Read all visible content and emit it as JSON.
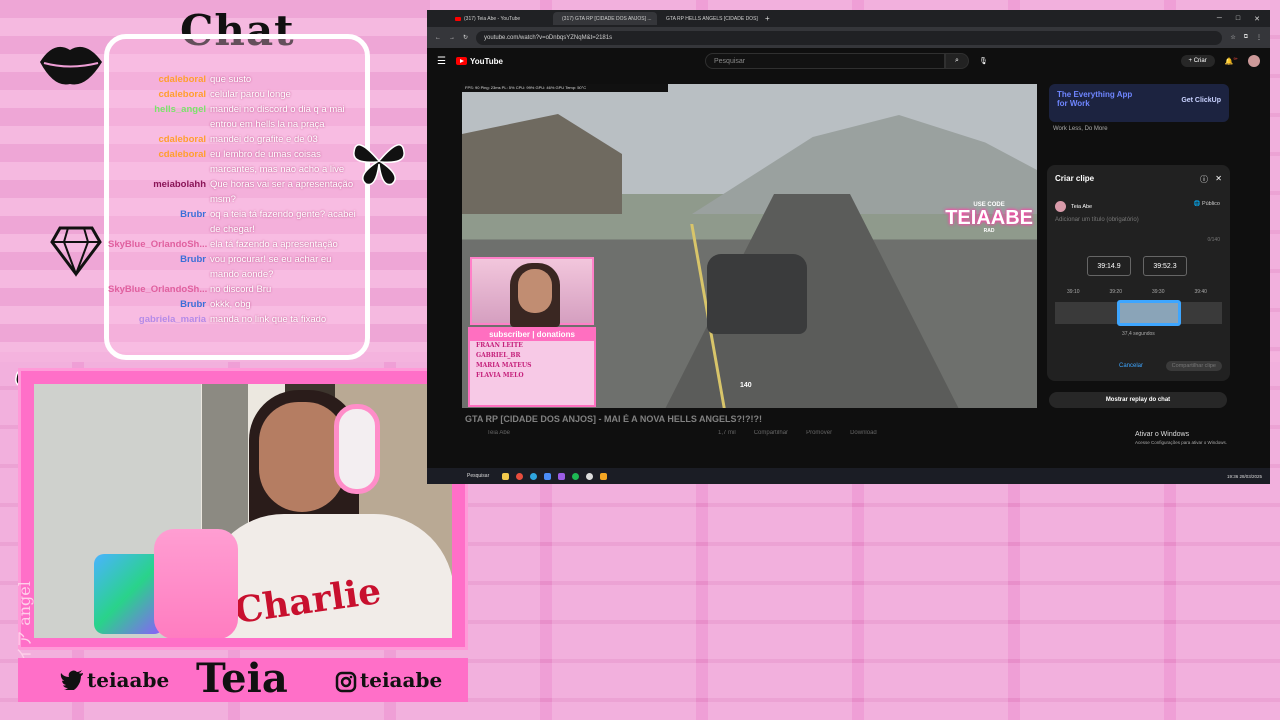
{
  "chat": {
    "title": "Chat",
    "messages": [
      {
        "user": "cdaleboral",
        "text": "que susto",
        "color": "#ff9f2e"
      },
      {
        "user": "cdaleboral",
        "text": "celular parou longe",
        "color": "#ff9f2e"
      },
      {
        "user": "hells_angel",
        "text": "mandei no discord o dia q a mai",
        "color": "#7be36b"
      },
      {
        "user": "",
        "text": "entrou em hells la na praça",
        "color": "#7be36b"
      },
      {
        "user": "cdaleboral",
        "text": "mandei do grafite e de 03",
        "color": "#ff9f2e"
      },
      {
        "user": "cdaleboral",
        "text": "eu lembro de umas coisas",
        "color": "#ff9f2e"
      },
      {
        "user": "",
        "text": "marcantes, mas nao acho a live",
        "color": "#ff9f2e"
      },
      {
        "user": "meiabolahh",
        "text": "Que horas vai ser a apresentação",
        "color": "#8a1457"
      },
      {
        "user": "",
        "text": "msm?",
        "color": "#8a1457"
      },
      {
        "user": "Brubr",
        "text": "oq a teia tá fazendo gente? acabei",
        "color": "#3a6fd8"
      },
      {
        "user": "",
        "text": "de chegar!",
        "color": "#3a6fd8"
      },
      {
        "user": "SkyBlue_OrlandoSh...",
        "text": "ela tá fazendo a apresentação",
        "color": "#e0609f"
      },
      {
        "user": "Brubr",
        "text": "vou procurar! se eu achar eu",
        "color": "#3a6fd8"
      },
      {
        "user": "",
        "text": "mando aonde?",
        "color": "#3a6fd8"
      },
      {
        "user": "SkyBlue_OrlandoSh...",
        "text": "no discord Bru",
        "color": "#e0609f"
      },
      {
        "user": "Brubr",
        "text": "okkk, obg",
        "color": "#3a6fd8"
      },
      {
        "user": "gabriela_maria",
        "text": "manda no link que ta fixado",
        "color": "#b58be8"
      }
    ]
  },
  "socials": {
    "twitter": "teiaabe",
    "brand": "Teia",
    "instagram": "teiaabe",
    "side_text": "テイア angel"
  },
  "webcam": {
    "shirt_text": "Charlie"
  },
  "browser": {
    "tabs": [
      {
        "label": "(317) Teia Abe - YouTube"
      },
      {
        "label": "(317) GTA RP [CIDADE DOS ANJOS] ..."
      },
      {
        "label": "GTA RP HELLS ANGELS [CIDADE DOS]"
      }
    ],
    "url": "youtube.com/watch?v=oDnbqsYZNqM&t=2181s",
    "search_placeholder": "Pesquisar",
    "create_label": "Criar",
    "notif_count": "9+",
    "logo": "YouTube"
  },
  "video": {
    "hud": "FPS: 90    Ping: 23ms  PL: 5%    CPU: 99%    GPU: 46%    GPU Temp: 50°C",
    "promo_line1": "USE CODE",
    "promo_line2": "TEIAABE",
    "promo_line3": "RAD",
    "speed": "140",
    "subs_header": "subscriber | donations",
    "subs": [
      "FRAAN LEITE",
      "GABRIEL_BR",
      "MARIA MATEUS",
      "FLAVIA MELO"
    ],
    "title": "GTA RP [CIDADE DOS ANJOS] - MAI É A NOVA HELLS ANGELS?!?!?!",
    "channel": "Teia Abe",
    "likes": "1,7 mil",
    "share": "Compartilhar",
    "promote": "Promover",
    "download": "Download"
  },
  "ad": {
    "line1": "The Everything App",
    "line2": "for Work",
    "cta": "Get ClickUp",
    "sub": "Work Less, Do More"
  },
  "clip": {
    "title": "Criar clipe",
    "channel": "Teia Abe",
    "visibility": "Público",
    "placeholder": "Adicionar um título (obrigatório)",
    "count": "0/140",
    "start": "39:14.9",
    "end": "39:52.3",
    "ticks": [
      "39:10",
      "39:20",
      "39:30",
      "39:40"
    ],
    "duration": "37,4 segundos",
    "cancel": "Cancelar",
    "share": "Compartilhar clipe"
  },
  "replay_label": "Mostrar replay do chat",
  "windows": {
    "activate": "Ativar o Windows",
    "activate_sub": "Acesse Configurações para ativar o Windows."
  },
  "taskbar": {
    "search": "Pesquisar",
    "time": "19:36",
    "date": "28/03/2025"
  },
  "colors": {
    "pink_bg": "#ef9fd6",
    "frame_pink": "#ff6fc8",
    "yt_red": "#ff0000",
    "clip_blue": "#3ea6ff"
  }
}
